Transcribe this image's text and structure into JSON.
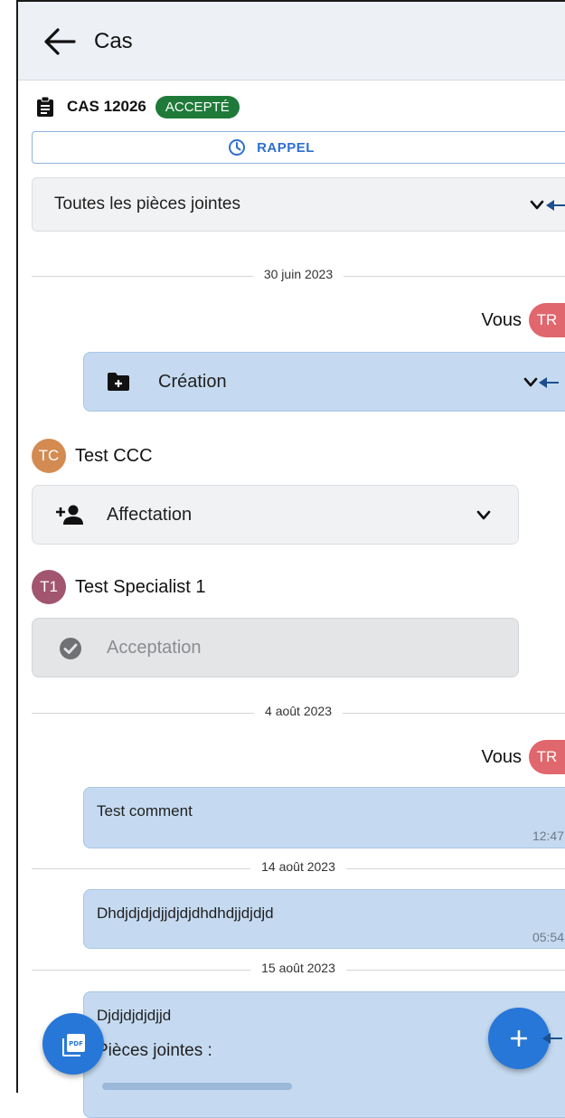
{
  "appbar": {
    "title": "Cas",
    "back_icon": "arrow-left-icon"
  },
  "case": {
    "number": "CAS 12026",
    "status": "ACCEPTÉ",
    "status_color": "#1f7a3a"
  },
  "reminder": {
    "label": "RAPPEL",
    "icon": "clock-icon"
  },
  "filter": {
    "selected": "Toutes les pièces jointes"
  },
  "timeline": {
    "date1": "30 juin 2023",
    "you_label": "Vous",
    "you_initials": "TR",
    "creation": {
      "label": "Création",
      "icon": "folder-plus-icon"
    },
    "author_tc": {
      "initials": "TC",
      "name": "Test CCC",
      "color": "#d38b52"
    },
    "assignment": {
      "label": "Affectation",
      "icon": "person-add-icon"
    },
    "author_t1": {
      "initials": "T1",
      "name": "Test Specialist 1",
      "color": "#a2556f"
    },
    "acceptance": {
      "label": "Acceptation",
      "icon": "check-circle-icon"
    },
    "date2": "4 août 2023",
    "you_label_2": "Vous",
    "you_initials_2": "TR",
    "msg1": {
      "text": "Test comment",
      "time": "12:47"
    },
    "date3": "14 août 2023",
    "msg2": {
      "text": "Dhdjdjdjdjjdjdjdhdhdjjdjdjd",
      "time": "05:54"
    },
    "date4": "15 août 2023",
    "msg3": {
      "text": "Djdjdjdjdjjd",
      "attachments_label": "Pièces jointes :"
    }
  },
  "fabs": {
    "pdf_icon": "pdf-icon",
    "add_icon": "plus-icon"
  },
  "colors": {
    "accent": "#2777d8",
    "bubble": "#c5daf0",
    "avatar_you": "#e0676d"
  }
}
